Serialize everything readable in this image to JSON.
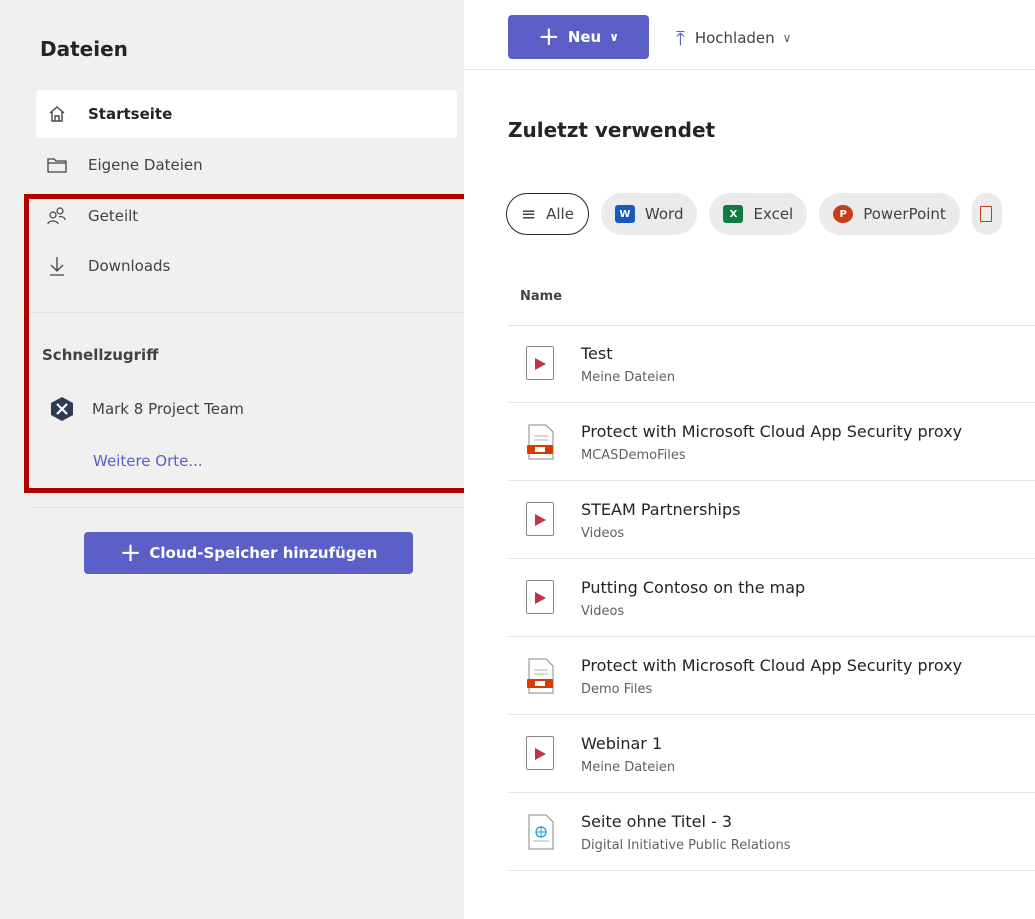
{
  "sidebar": {
    "title": "Dateien",
    "nav": [
      {
        "label": "Startseite"
      },
      {
        "label": "Eigene Dateien"
      },
      {
        "label": "Geteilt"
      },
      {
        "label": "Downloads"
      }
    ],
    "quick_access": {
      "title": "Schnellzugriff",
      "items": [
        {
          "label": "Mark 8 Project Team"
        }
      ],
      "more_link": "Weitere Orte..."
    },
    "cloud_button": "Cloud-Speicher hinzufügen"
  },
  "toolbar": {
    "new_label": "Neu",
    "upload_label": "Hochladen"
  },
  "main": {
    "section_title": "Zuletzt verwendet",
    "filters": [
      {
        "label": "Alle"
      },
      {
        "label": "Word",
        "badge": "W",
        "color": "#185abd"
      },
      {
        "label": "Excel",
        "badge": "X",
        "color": "#107c41"
      },
      {
        "label": "PowerPoint",
        "badge": "P",
        "color": "#c43e1c"
      }
    ],
    "column_name": "Name",
    "files": [
      {
        "name": "Test",
        "location": "Meine Dateien",
        "icon": "video-file-icon"
      },
      {
        "name": "Protect with Microsoft Cloud App Security proxy",
        "location": "MCASDemoFiles",
        "icon": "sway-file-icon"
      },
      {
        "name": "STEAM Partnerships",
        "location": "Videos",
        "icon": "video-file-icon"
      },
      {
        "name": "Putting Contoso on the map",
        "location": "Videos",
        "icon": "video-file-icon"
      },
      {
        "name": "Protect with Microsoft Cloud App Security proxy",
        "location": "Demo Files",
        "icon": "sway-file-icon"
      },
      {
        "name": "Webinar 1",
        "location": "Meine Dateien",
        "icon": "video-file-icon"
      },
      {
        "name": "Seite ohne Titel - 3",
        "location": "Digital Initiative Public Relations",
        "icon": "web-page-file-icon"
      }
    ]
  },
  "colors": {
    "accent": "#5b5fc7",
    "highlight_border": "#b30000",
    "sidebar_bg": "#f0f0f0"
  }
}
